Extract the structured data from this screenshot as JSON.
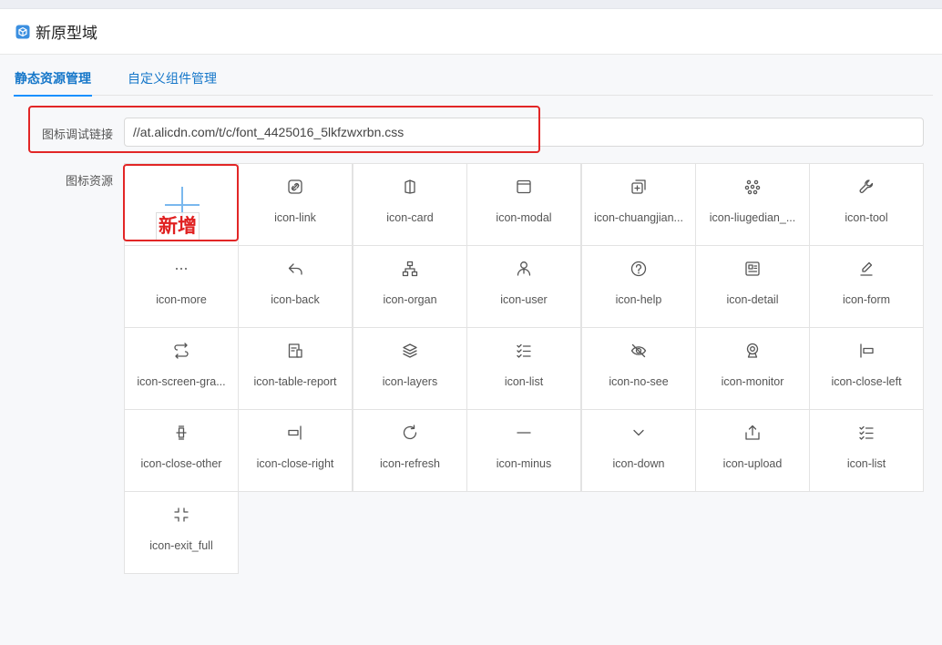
{
  "header": {
    "title": "新原型域",
    "icon": "cube-icon"
  },
  "tabs": [
    {
      "label": "静态资源管理",
      "active": true
    },
    {
      "label": "自定义组件管理",
      "active": false
    }
  ],
  "form": {
    "link_label": "图标调试链接",
    "link_value": "//at.alicdn.com/t/c/font_4425016_5lkfzwxrbn.css",
    "resources_label": "图标资源"
  },
  "add_tile": {
    "annotation": "新增"
  },
  "icons": [
    {
      "label": "icon-link",
      "icon": "link-icon"
    },
    {
      "label": "icon-card",
      "icon": "card-icon"
    },
    {
      "label": "icon-modal",
      "icon": "modal-icon"
    },
    {
      "label": "icon-chuangjian...",
      "icon": "create-icon"
    },
    {
      "label": "icon-liugedian_...",
      "icon": "six-dots-icon"
    },
    {
      "label": "icon-tool",
      "icon": "wrench-icon"
    },
    {
      "label": "icon-more",
      "icon": "more-icon"
    },
    {
      "label": "icon-back",
      "icon": "back-icon"
    },
    {
      "label": "icon-organ",
      "icon": "organ-icon"
    },
    {
      "label": "icon-user",
      "icon": "user-icon"
    },
    {
      "label": "icon-help",
      "icon": "help-icon"
    },
    {
      "label": "icon-detail",
      "icon": "detail-icon"
    },
    {
      "label": "icon-form",
      "icon": "form-icon"
    },
    {
      "label": "icon-screen-gra...",
      "icon": "screen-graph-icon"
    },
    {
      "label": "icon-table-report",
      "icon": "table-report-icon"
    },
    {
      "label": "icon-layers",
      "icon": "layers-icon"
    },
    {
      "label": "icon-list",
      "icon": "list-icon"
    },
    {
      "label": "icon-no-see",
      "icon": "eye-off-icon"
    },
    {
      "label": "icon-monitor",
      "icon": "webcam-icon"
    },
    {
      "label": "icon-close-left",
      "icon": "close-left-icon"
    },
    {
      "label": "icon-close-other",
      "icon": "close-other-icon"
    },
    {
      "label": "icon-close-right",
      "icon": "close-right-icon"
    },
    {
      "label": "icon-refresh",
      "icon": "refresh-icon"
    },
    {
      "label": "icon-minus",
      "icon": "minus-icon"
    },
    {
      "label": "icon-down",
      "icon": "chevron-down-icon"
    },
    {
      "label": "icon-upload",
      "icon": "upload-icon"
    },
    {
      "label": "icon-list",
      "icon": "list-icon"
    },
    {
      "label": "icon-exit_full",
      "icon": "exit-fullscreen-icon"
    }
  ],
  "colors": {
    "accent": "#1890ff",
    "highlight": "#e22626"
  }
}
